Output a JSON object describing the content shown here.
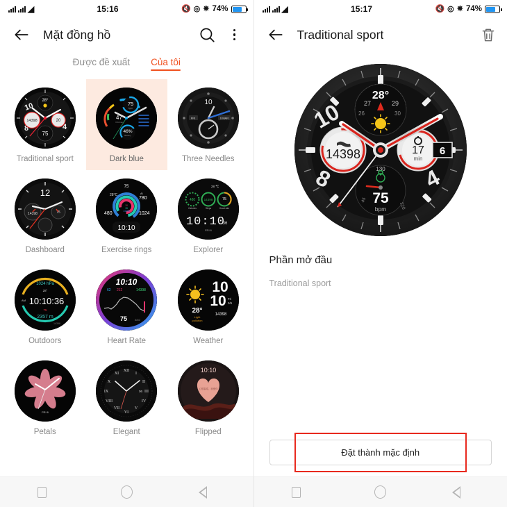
{
  "left_screen": {
    "status_bar": {
      "time": "15:16",
      "battery_percent": "74%",
      "icons": [
        "signal-icon",
        "signal-icon",
        "wifi-icon",
        "mute-icon",
        "rotation-lock-icon",
        "bluetooth-icon",
        "battery-icon"
      ]
    },
    "app_bar": {
      "title": "Mặt đồng hồ",
      "back_icon": "back-arrow-icon",
      "search_icon": "search-icon",
      "overflow_icon": "more-vertical-icon"
    },
    "tabs": [
      {
        "label": "Được đề xuất",
        "active": false
      },
      {
        "label": "Của tôi",
        "active": true
      }
    ],
    "watch_faces": [
      {
        "label": "Traditional sport",
        "selected": false,
        "style": "traditional",
        "values": {
          "temp": "28°",
          "steps": "14398",
          "timer": "20",
          "bpm": "75",
          "date": "6",
          "numerals": [
            "10",
            "8",
            "4"
          ]
        }
      },
      {
        "label": "Dark blue",
        "selected": true,
        "style": "darkblue",
        "values": {
          "bpm": "75",
          "vo2max": "47",
          "battery": "46%"
        }
      },
      {
        "label": "Three Needles",
        "selected": false,
        "style": "threeneedles",
        "values": {
          "numeral": "10",
          "day": "FRI",
          "date": "6 MAR"
        }
      },
      {
        "label": "Dashboard",
        "selected": false,
        "style": "dashboard",
        "values": {
          "numeral": "12",
          "steps": "14398",
          "bpm": "75"
        }
      },
      {
        "label": "Exercise rings",
        "selected": false,
        "style": "rings",
        "values": {
          "bpm": "75",
          "temp": "28°C",
          "altitude": "780",
          "calories": "480",
          "pressure": "1024",
          "steps": "14398",
          "time": "10:10"
        }
      },
      {
        "label": "Explorer",
        "selected": false,
        "style": "explorer",
        "values": {
          "temp": "28 °C",
          "calories": "480",
          "steps": "14398",
          "bpm": "75",
          "calories_label": "Calories",
          "steps_label": "Steps",
          "bpm_label": "Heart rate",
          "time": "10:10",
          "seconds": "36",
          "date": "FRI 6"
        }
      },
      {
        "label": "Outdoors",
        "selected": false,
        "style": "outdoors",
        "values": {
          "pressure": "1024 hPa",
          "temp": "28°",
          "meridiem": "AM",
          "time": "10:10:36",
          "bpm": "75",
          "altitude": "2357 m",
          "steps": "14398"
        }
      },
      {
        "label": "Heart Rate",
        "selected": false,
        "style": "heartrate",
        "values": {
          "time": "10:10",
          "low": "62",
          "high": "212",
          "steps": "14398",
          "bpm": "75",
          "range": "2/10"
        }
      },
      {
        "label": "Weather",
        "selected": false,
        "style": "weather",
        "values": {
          "hour": "10",
          "minute": "10",
          "temp": "28°",
          "condition": "Light pollution",
          "day": "Fri",
          "date": "3/6",
          "steps": "14398"
        }
      },
      {
        "label": "Petals",
        "selected": false,
        "style": "petals",
        "values": {
          "date": "FRI 6"
        }
      },
      {
        "label": "Elegant",
        "selected": false,
        "style": "elegant",
        "values": {
          "date": "06"
        }
      },
      {
        "label": "Flipped",
        "selected": false,
        "style": "flipped",
        "values": {
          "time": "10:10",
          "quote": "心想事成，我爱你"
        }
      }
    ]
  },
  "right_screen": {
    "status_bar": {
      "time": "15:17",
      "battery_percent": "74%"
    },
    "app_bar": {
      "title": "Traditional sport",
      "back_icon": "back-arrow-icon",
      "delete_icon": "trash-icon"
    },
    "preview": {
      "style": "traditional",
      "values": {
        "temp": "28°",
        "temp_scale_left": "27",
        "temp_scale_left2": "26",
        "temp_scale_right": "29",
        "temp_scale_right2": "30",
        "weather_icon": "sun-icon",
        "steps": "14398",
        "steps_icon": "shoe-icon",
        "timer_value": "17",
        "timer_unit": "min",
        "timer_icon": "stopwatch-icon",
        "bpm": "75",
        "bpm_unit": "bpm",
        "bpm_max": "130",
        "bpm_icon": "heart-icon",
        "date": "6",
        "numerals": [
          "10",
          "8",
          "4"
        ]
      }
    },
    "section": {
      "title": "Phần mở đầu",
      "subtitle": "Traditional sport"
    },
    "primary_button": {
      "label": "Đặt thành mặc định",
      "highlight_color": "#e8291e"
    }
  },
  "nav_bar": {
    "recents_icon": "square-icon",
    "home_icon": "circle-icon",
    "back_icon": "triangle-back-icon"
  },
  "colors": {
    "accent": "#f0501e",
    "selected_bg": "#fdeae0",
    "battery_blue": "#2196f3",
    "highlight_red": "#e8291e"
  }
}
